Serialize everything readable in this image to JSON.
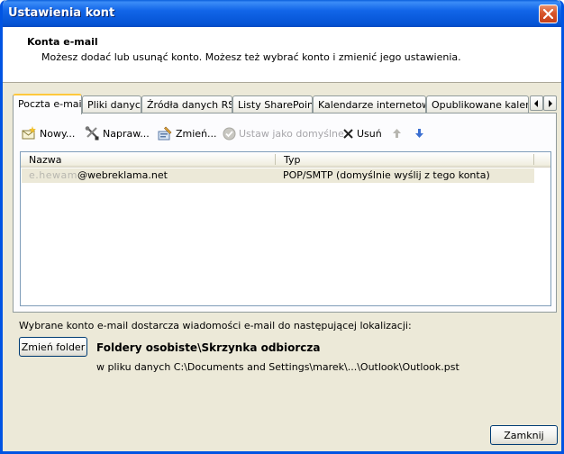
{
  "window": {
    "title": "Ustawienia kont"
  },
  "header": {
    "title": "Konta e-mail",
    "subtitle": "Możesz dodać lub usunąć konto. Możesz też wybrać konto i zmienić jego ustawienia."
  },
  "tabs": [
    {
      "label": "Poczta e-mail",
      "active": true
    },
    {
      "label": "Pliki danych",
      "active": false
    },
    {
      "label": "Źródła danych RSS",
      "active": false
    },
    {
      "label": "Listy SharePoint",
      "active": false
    },
    {
      "label": "Kalendarze internetowe",
      "active": false
    },
    {
      "label": "Opublikowane kalendarze",
      "active": false
    }
  ],
  "toolbar": {
    "new_label": "Nowy...",
    "repair_label": "Napraw...",
    "change_label": "Zmień...",
    "set_default_label": "Ustaw jako domyślne",
    "remove_label": "Usuń"
  },
  "accounts_list": {
    "columns": [
      "Nazwa",
      "Typ"
    ],
    "rows": [
      {
        "name_hidden_part": "e.hewam",
        "name_domain": "@webreklama.net",
        "type": "POP/SMTP (domyślnie wyślij z tego konta)",
        "selected": true
      }
    ]
  },
  "delivery": {
    "label": "Wybrane konto e-mail dostarcza wiadomości e-mail do następującej lokalizacji:",
    "change_folder_label": "Zmień folder",
    "folder": "Foldery osobiste\\Skrzynka odbiorcza",
    "data_file": "w pliku danych C:\\Documents and Settings\\marek\\...\\Outlook\\Outlook.pst"
  },
  "footer": {
    "close_label": "Zamknij"
  },
  "colors": {
    "title_bar": "#0553d4",
    "dialog_bg": "#ece9d8",
    "close_button": "#d8552a",
    "tab_active_accent": "#ffc83c"
  }
}
